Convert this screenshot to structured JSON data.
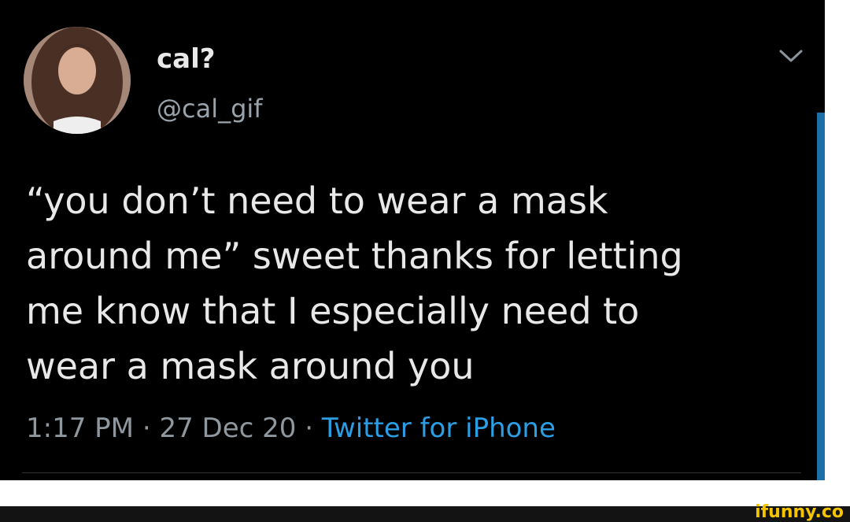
{
  "tweet": {
    "author": {
      "display_name": "cal?",
      "handle": "@cal_gif"
    },
    "text": "“you don’t need to wear a mask\naround me” sweet thanks for letting\nme know that I especially need to\nwear a mask around you",
    "time": "1:17 PM",
    "separator": "·",
    "date": "27 Dec 20",
    "source": "Twitter for iPhone"
  },
  "watermark": {
    "text": "ifunny.co"
  },
  "colors": {
    "background": "#000000",
    "text": "#e8e8e8",
    "meta": "#8f979f",
    "link": "#2b9ee4",
    "watermark": "#f5c400"
  },
  "icons": {
    "menu": "chevron-down-icon"
  }
}
